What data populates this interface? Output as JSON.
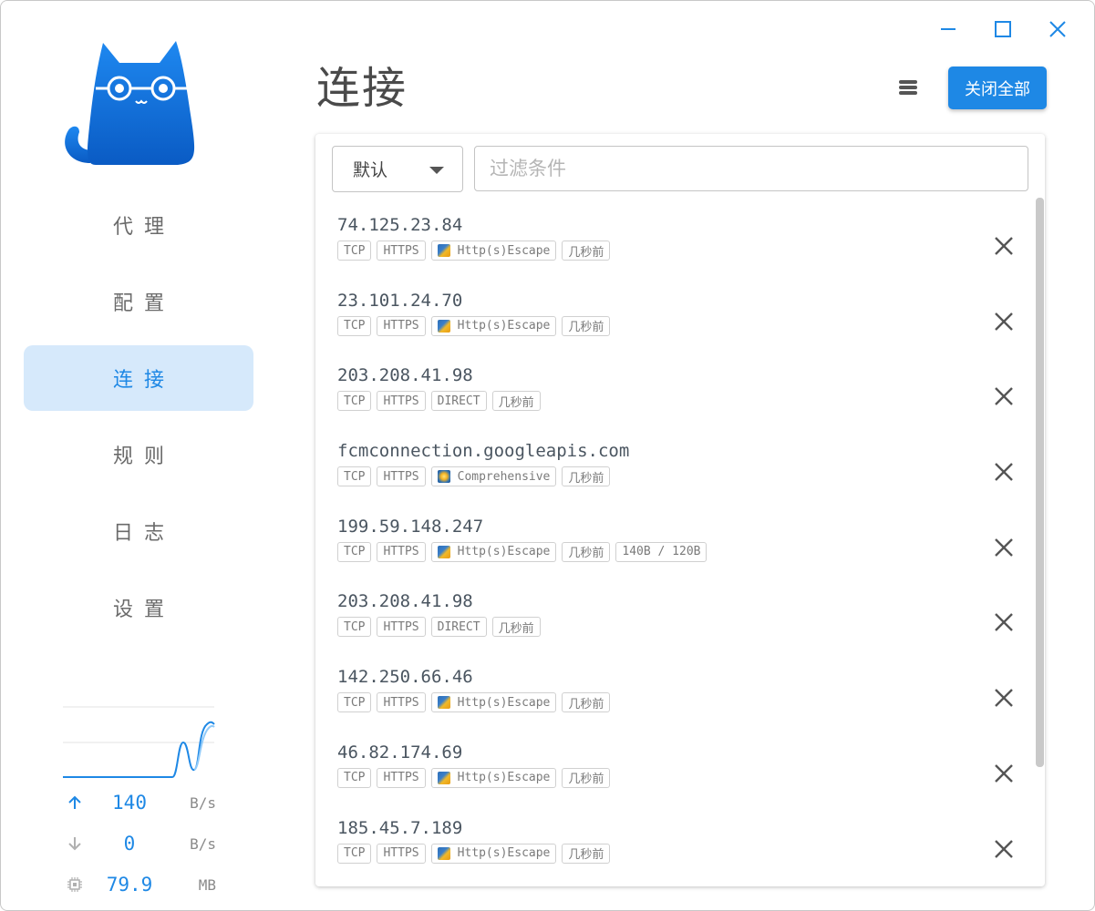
{
  "window": {
    "accent": "#1e88e5"
  },
  "nav": {
    "items": [
      {
        "label": "代理",
        "active": false
      },
      {
        "label": "配置",
        "active": false
      },
      {
        "label": "连接",
        "active": true
      },
      {
        "label": "规则",
        "active": false
      },
      {
        "label": "日志",
        "active": false
      },
      {
        "label": "设置",
        "active": false
      }
    ]
  },
  "stats": {
    "upload": {
      "value": "140",
      "unit": "B/s",
      "icon": "arrow-up-icon"
    },
    "download": {
      "value": "0",
      "unit": "B/s",
      "icon": "arrow-down-icon"
    },
    "memory": {
      "value": "79.9",
      "unit": "MB",
      "icon": "chip-icon"
    }
  },
  "header": {
    "title": "连接",
    "close_all_label": "关闭全部"
  },
  "toolbar": {
    "group_select_value": "默认",
    "filter_placeholder": "过滤条件"
  },
  "connections": [
    {
      "host": "74.125.23.84",
      "tags": [
        "TCP",
        "HTTPS"
      ],
      "proxy": "Http(s)Escape",
      "proxy_icon": "escape",
      "time": "几秒前",
      "traffic": ""
    },
    {
      "host": "23.101.24.70",
      "tags": [
        "TCP",
        "HTTPS"
      ],
      "proxy": "Http(s)Escape",
      "proxy_icon": "escape",
      "time": "几秒前",
      "traffic": ""
    },
    {
      "host": "203.208.41.98",
      "tags": [
        "TCP",
        "HTTPS"
      ],
      "proxy": "DIRECT",
      "proxy_icon": "",
      "time": "几秒前",
      "traffic": ""
    },
    {
      "host": "fcmconnection.googleapis.com",
      "tags": [
        "TCP",
        "HTTPS"
      ],
      "proxy": "Comprehensive",
      "proxy_icon": "comp",
      "time": "几秒前",
      "traffic": ""
    },
    {
      "host": "199.59.148.247",
      "tags": [
        "TCP",
        "HTTPS"
      ],
      "proxy": "Http(s)Escape",
      "proxy_icon": "escape",
      "time": "几秒前",
      "traffic": "140B / 120B"
    },
    {
      "host": "203.208.41.98",
      "tags": [
        "TCP",
        "HTTPS"
      ],
      "proxy": "DIRECT",
      "proxy_icon": "",
      "time": "几秒前",
      "traffic": ""
    },
    {
      "host": "142.250.66.46",
      "tags": [
        "TCP",
        "HTTPS"
      ],
      "proxy": "Http(s)Escape",
      "proxy_icon": "escape",
      "time": "几秒前",
      "traffic": ""
    },
    {
      "host": "46.82.174.69",
      "tags": [
        "TCP",
        "HTTPS"
      ],
      "proxy": "Http(s)Escape",
      "proxy_icon": "escape",
      "time": "几秒前",
      "traffic": ""
    },
    {
      "host": "185.45.7.189",
      "tags": [
        "TCP",
        "HTTPS"
      ],
      "proxy": "Http(s)Escape",
      "proxy_icon": "escape",
      "time": "几秒前",
      "traffic": ""
    }
  ]
}
